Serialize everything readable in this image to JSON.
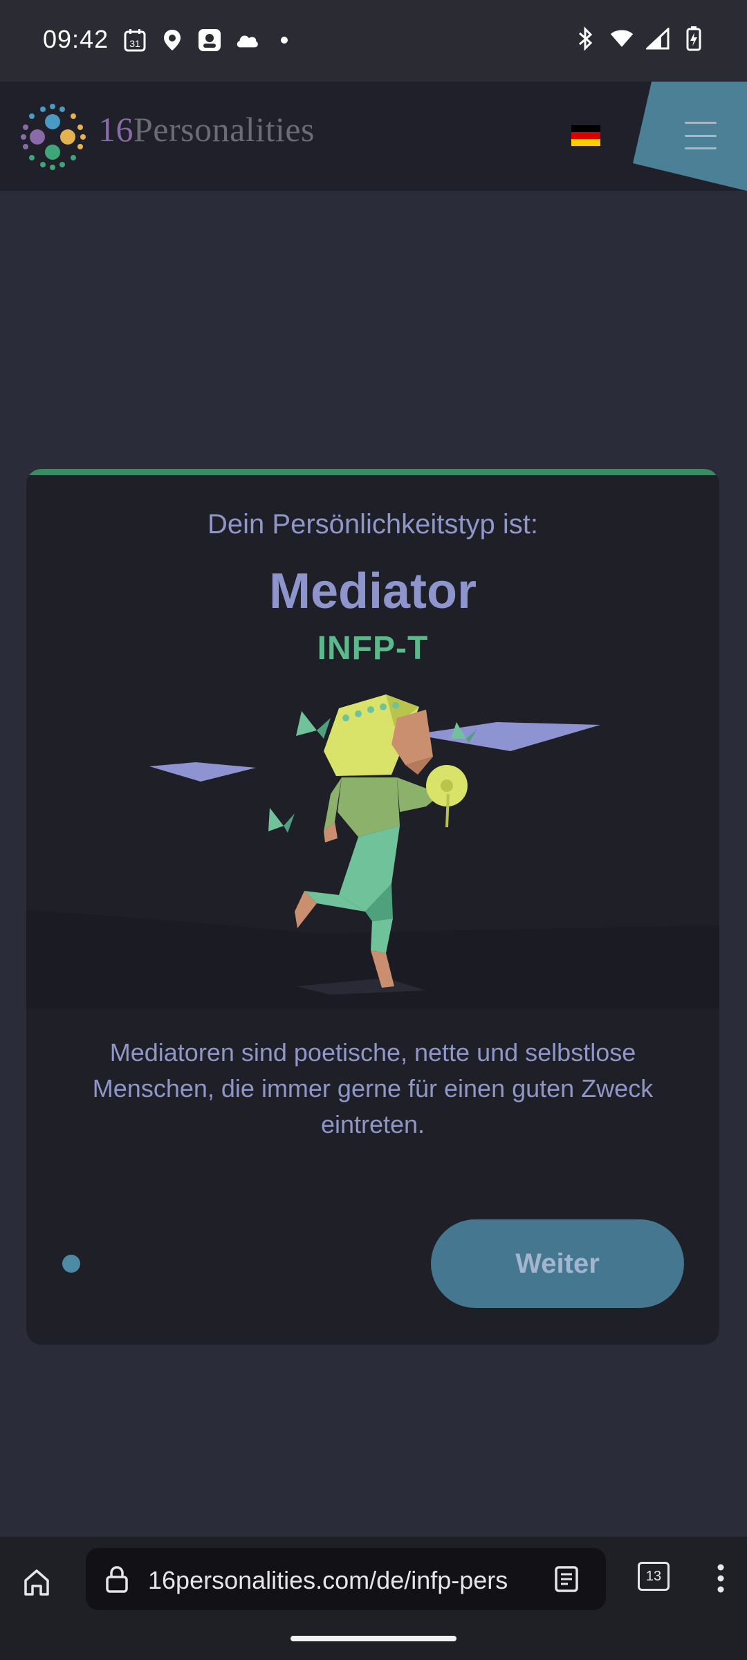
{
  "status_bar": {
    "time": "09:42",
    "left_icons": [
      "calendar-icon",
      "maps-icon",
      "assistant-icon",
      "cloud-icon",
      "dot-icon"
    ],
    "right_icons": [
      "bluetooth-icon",
      "wifi-icon",
      "signal-icon",
      "battery-charging-icon"
    ],
    "calendar_day": "31"
  },
  "header": {
    "brand_number": "16",
    "brand_word": "Personalities",
    "language_flag": "de",
    "flag_colors": [
      "#000000",
      "#dd0000",
      "#ffce00"
    ],
    "menu_accent": "#4b8097"
  },
  "result": {
    "intro": "Dein Persönlichkeitstyp ist:",
    "type_name": "Mediator",
    "type_code": "INFP-T",
    "description": "Mediatoren sind poetische, nette und selbstlose Menschen, die immer gerne für einen guten Zweck eintreten.",
    "button_label": "Weiter",
    "accent_color": "#3a8a64"
  },
  "browser": {
    "url": "16personalities.com/de/infp-pers",
    "tab_count": "13"
  }
}
